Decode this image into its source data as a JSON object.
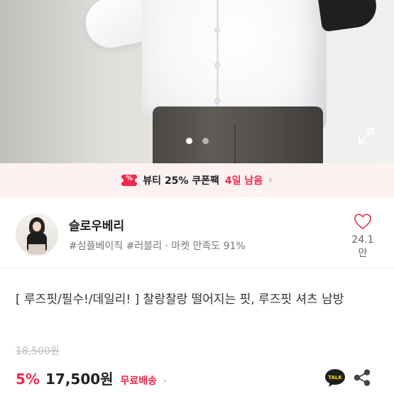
{
  "colors": {
    "accent": "#f0294a",
    "coupon_bg": "#fdf1f2"
  },
  "hero": {
    "slide_count": 2,
    "active_slide": 1,
    "expand_icon": "expand-icon"
  },
  "coupon": {
    "icon_glyph": "%",
    "text": "뷰티 25% 쿠폰팩",
    "days_left": "4일 남음",
    "chevron": "›"
  },
  "seller": {
    "name": "슬로우베리",
    "tags": "#심플베이직 #러블리 · 마켓 만족도 91%",
    "likes": "24.1만"
  },
  "product": {
    "title": "[ 루즈핏/필수!/데일리! ] 찰랑찰랑 떨어지는 핏, 루즈핏 셔츠 남방",
    "original_price": "18,500원",
    "discount": "5%",
    "price": "17,500원",
    "shipping": "무료배송",
    "shipping_chevron": "›",
    "talk_label": "TALK"
  }
}
